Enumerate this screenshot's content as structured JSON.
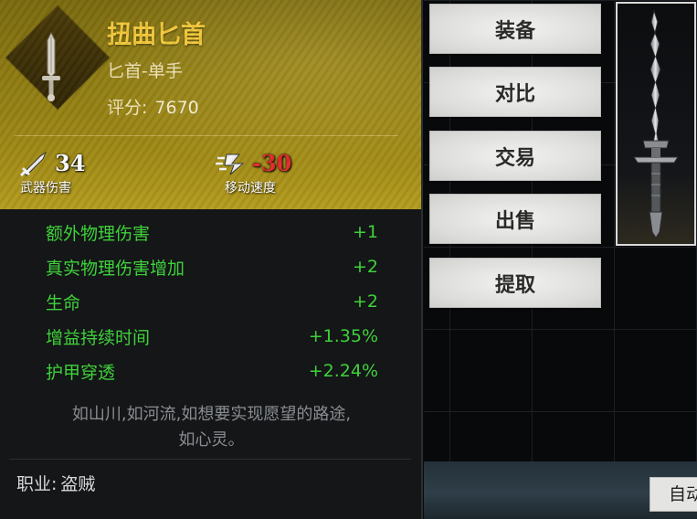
{
  "item": {
    "name": "扭曲匕首",
    "type": "匕首-单手",
    "score_label": "评分:",
    "score_value": "7670",
    "icon": "dagger-icon",
    "rarity_color": "#a08a16"
  },
  "stats": {
    "damage": {
      "value": "34",
      "label": "武器伤害",
      "icon": "sword-icon"
    },
    "speed": {
      "value": "-30",
      "label": "移动速度",
      "icon": "speed-icon",
      "color": "#e02a2a"
    }
  },
  "attributes": [
    {
      "name": "额外物理伤害",
      "value": "+1"
    },
    {
      "name": "真实物理伤害增加",
      "value": "+2"
    },
    {
      "name": "生命",
      "value": "+2"
    },
    {
      "name": "增益持续时间",
      "value": "+1.35%"
    },
    {
      "name": "护甲穿透",
      "value": "+2.24%"
    }
  ],
  "attribute_color": "#3fd13a",
  "flavor": {
    "line1": "如山川,如河流,如想要实现愿望的路途,",
    "line2": "如心灵。"
  },
  "class_req": {
    "label": "职业:",
    "value": "盗贼"
  },
  "actions": {
    "equip": "装备",
    "compare": "对比",
    "trade": "交易",
    "sell": "出售",
    "extract": "提取"
  },
  "auto_button": "自动"
}
